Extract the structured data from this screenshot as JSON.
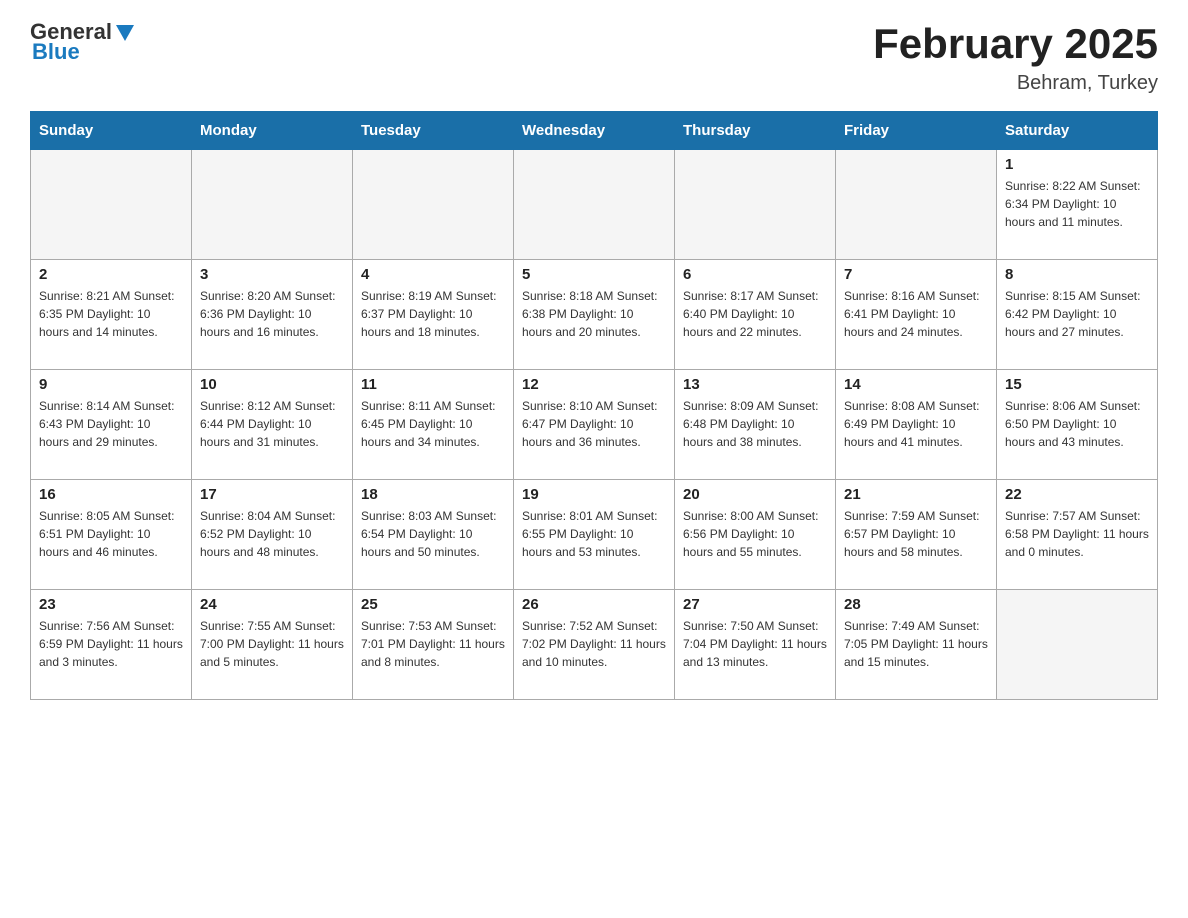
{
  "header": {
    "logo_general": "General",
    "logo_blue": "Blue",
    "month_title": "February 2025",
    "location": "Behram, Turkey"
  },
  "days_of_week": [
    "Sunday",
    "Monday",
    "Tuesday",
    "Wednesday",
    "Thursday",
    "Friday",
    "Saturday"
  ],
  "weeks": [
    [
      {
        "day": "",
        "details": ""
      },
      {
        "day": "",
        "details": ""
      },
      {
        "day": "",
        "details": ""
      },
      {
        "day": "",
        "details": ""
      },
      {
        "day": "",
        "details": ""
      },
      {
        "day": "",
        "details": ""
      },
      {
        "day": "1",
        "details": "Sunrise: 8:22 AM\nSunset: 6:34 PM\nDaylight: 10 hours and 11 minutes."
      }
    ],
    [
      {
        "day": "2",
        "details": "Sunrise: 8:21 AM\nSunset: 6:35 PM\nDaylight: 10 hours and 14 minutes."
      },
      {
        "day": "3",
        "details": "Sunrise: 8:20 AM\nSunset: 6:36 PM\nDaylight: 10 hours and 16 minutes."
      },
      {
        "day": "4",
        "details": "Sunrise: 8:19 AM\nSunset: 6:37 PM\nDaylight: 10 hours and 18 minutes."
      },
      {
        "day": "5",
        "details": "Sunrise: 8:18 AM\nSunset: 6:38 PM\nDaylight: 10 hours and 20 minutes."
      },
      {
        "day": "6",
        "details": "Sunrise: 8:17 AM\nSunset: 6:40 PM\nDaylight: 10 hours and 22 minutes."
      },
      {
        "day": "7",
        "details": "Sunrise: 8:16 AM\nSunset: 6:41 PM\nDaylight: 10 hours and 24 minutes."
      },
      {
        "day": "8",
        "details": "Sunrise: 8:15 AM\nSunset: 6:42 PM\nDaylight: 10 hours and 27 minutes."
      }
    ],
    [
      {
        "day": "9",
        "details": "Sunrise: 8:14 AM\nSunset: 6:43 PM\nDaylight: 10 hours and 29 minutes."
      },
      {
        "day": "10",
        "details": "Sunrise: 8:12 AM\nSunset: 6:44 PM\nDaylight: 10 hours and 31 minutes."
      },
      {
        "day": "11",
        "details": "Sunrise: 8:11 AM\nSunset: 6:45 PM\nDaylight: 10 hours and 34 minutes."
      },
      {
        "day": "12",
        "details": "Sunrise: 8:10 AM\nSunset: 6:47 PM\nDaylight: 10 hours and 36 minutes."
      },
      {
        "day": "13",
        "details": "Sunrise: 8:09 AM\nSunset: 6:48 PM\nDaylight: 10 hours and 38 minutes."
      },
      {
        "day": "14",
        "details": "Sunrise: 8:08 AM\nSunset: 6:49 PM\nDaylight: 10 hours and 41 minutes."
      },
      {
        "day": "15",
        "details": "Sunrise: 8:06 AM\nSunset: 6:50 PM\nDaylight: 10 hours and 43 minutes."
      }
    ],
    [
      {
        "day": "16",
        "details": "Sunrise: 8:05 AM\nSunset: 6:51 PM\nDaylight: 10 hours and 46 minutes."
      },
      {
        "day": "17",
        "details": "Sunrise: 8:04 AM\nSunset: 6:52 PM\nDaylight: 10 hours and 48 minutes."
      },
      {
        "day": "18",
        "details": "Sunrise: 8:03 AM\nSunset: 6:54 PM\nDaylight: 10 hours and 50 minutes."
      },
      {
        "day": "19",
        "details": "Sunrise: 8:01 AM\nSunset: 6:55 PM\nDaylight: 10 hours and 53 minutes."
      },
      {
        "day": "20",
        "details": "Sunrise: 8:00 AM\nSunset: 6:56 PM\nDaylight: 10 hours and 55 minutes."
      },
      {
        "day": "21",
        "details": "Sunrise: 7:59 AM\nSunset: 6:57 PM\nDaylight: 10 hours and 58 minutes."
      },
      {
        "day": "22",
        "details": "Sunrise: 7:57 AM\nSunset: 6:58 PM\nDaylight: 11 hours and 0 minutes."
      }
    ],
    [
      {
        "day": "23",
        "details": "Sunrise: 7:56 AM\nSunset: 6:59 PM\nDaylight: 11 hours and 3 minutes."
      },
      {
        "day": "24",
        "details": "Sunrise: 7:55 AM\nSunset: 7:00 PM\nDaylight: 11 hours and 5 minutes."
      },
      {
        "day": "25",
        "details": "Sunrise: 7:53 AM\nSunset: 7:01 PM\nDaylight: 11 hours and 8 minutes."
      },
      {
        "day": "26",
        "details": "Sunrise: 7:52 AM\nSunset: 7:02 PM\nDaylight: 11 hours and 10 minutes."
      },
      {
        "day": "27",
        "details": "Sunrise: 7:50 AM\nSunset: 7:04 PM\nDaylight: 11 hours and 13 minutes."
      },
      {
        "day": "28",
        "details": "Sunrise: 7:49 AM\nSunset: 7:05 PM\nDaylight: 11 hours and 15 minutes."
      },
      {
        "day": "",
        "details": ""
      }
    ]
  ]
}
